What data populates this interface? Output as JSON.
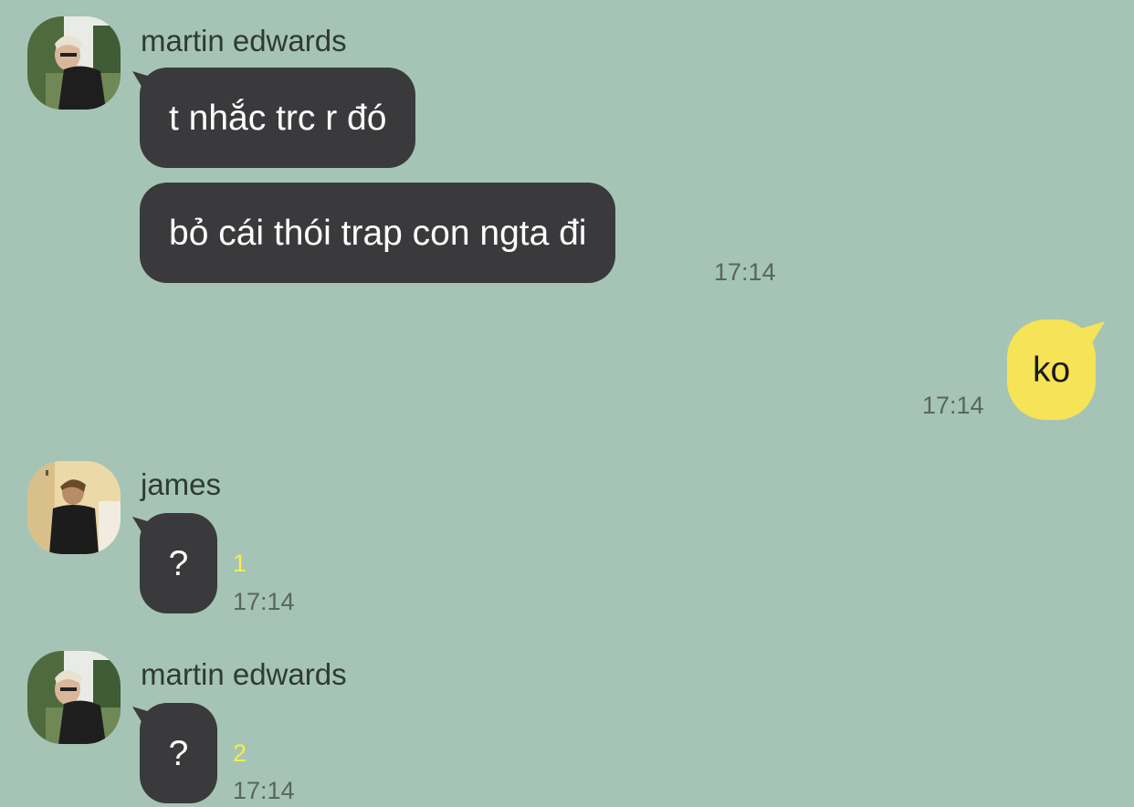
{
  "colors": {
    "background": "#a5c4b5",
    "incoming_bubble": "#3a3a3c",
    "outgoing_bubble": "#f7e357",
    "unread_count": "#f4ee4c"
  },
  "messages": [
    {
      "sender": "martin edwards",
      "bubbles": [
        "t nhắc trc r đó",
        "bỏ cái thói trap con ngta đi"
      ],
      "time": "17:14"
    },
    {
      "sender": "me",
      "bubbles": [
        "ko"
      ],
      "time": "17:14"
    },
    {
      "sender": "james",
      "bubbles": [
        "?"
      ],
      "unread": "1",
      "time": "17:14"
    },
    {
      "sender": "martin edwards",
      "bubbles": [
        "?"
      ],
      "unread": "2",
      "time": "17:14"
    }
  ]
}
